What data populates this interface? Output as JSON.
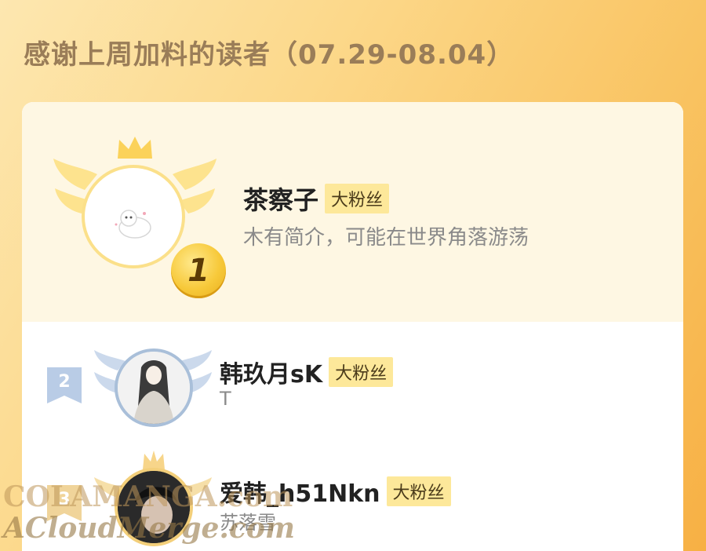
{
  "header": {
    "title": "感谢上周加料的读者（07.29-08.04）"
  },
  "readers": [
    {
      "rank": "1",
      "name": "茶察子",
      "badge": "大粉丝",
      "bio": "木有简介，可能在世界角落游荡"
    },
    {
      "rank": "2",
      "name": "韩玖月sK",
      "badge": "大粉丝",
      "bio": "T"
    },
    {
      "rank": "3",
      "name": "爱韩_h51Nkn",
      "badge": "大粉丝",
      "bio": "苏落雪"
    }
  ],
  "watermark": {
    "line1": "COLAMANGA.com",
    "line2": "ACloudMerge.com"
  },
  "colors": {
    "gold": "#f7c93a",
    "silver": "#a9bfd9",
    "badge_bg": "#fde89a"
  }
}
